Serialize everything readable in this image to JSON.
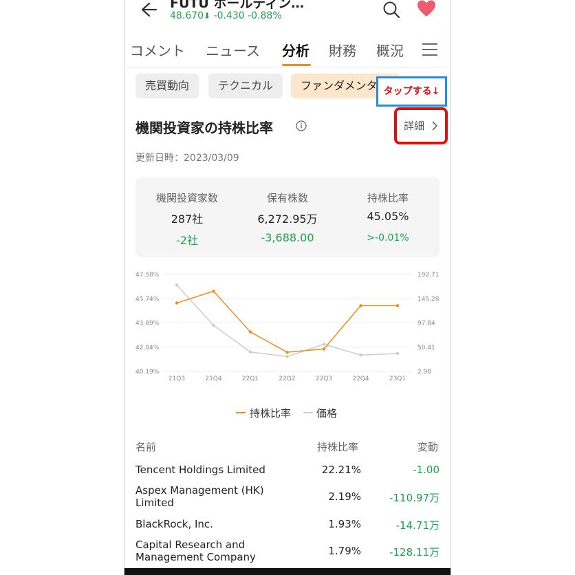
{
  "header": {
    "title": "FUTU ホールディン…",
    "price": "48.670",
    "change": "-0.430",
    "change_pct": "-0.88%",
    "down_arrow": "⬇"
  },
  "tabs": [
    {
      "label": "コメント"
    },
    {
      "label": "ニュース"
    },
    {
      "label": "分析"
    },
    {
      "label": "財務"
    },
    {
      "label": "概況"
    }
  ],
  "chips": [
    {
      "label": "売買動向"
    },
    {
      "label": "テクニカル"
    },
    {
      "label": "ファンダメンタ"
    }
  ],
  "annotation": {
    "tap_text": "タップする↓"
  },
  "section": {
    "title": "機関投資家の持株比率",
    "detail_link": "詳細",
    "updated": "更新日時：2023/03/09"
  },
  "stats": [
    {
      "label": "機関投資家数",
      "value": "287社",
      "change": "-2社"
    },
    {
      "label": "保有株数",
      "value": "6,272.95万",
      "change": "-3,688.00"
    },
    {
      "label": "持株比率",
      "value": "45.05%",
      "change": ">-0.01%"
    }
  ],
  "colors": {
    "accent": "#f08c1c",
    "down_green": "#1aa34a",
    "price_line": "#cccccc",
    "annotation_red": "#e01010",
    "annotation_blue": "#1e8ee9"
  },
  "chart_data": {
    "type": "line",
    "categories": [
      "21Q3",
      "21Q4",
      "22Q1",
      "22Q2",
      "22Q3",
      "22Q4",
      "23Q1"
    ],
    "left_axis_ticks": [
      "47.58%",
      "45.74%",
      "43.89%",
      "42.04%",
      "40.19%"
    ],
    "right_axis_ticks": [
      "192.71",
      "145.28",
      "97.84",
      "50.41",
      "2.98"
    ],
    "left_ylim": [
      40.19,
      47.58
    ],
    "right_ylim": [
      2.98,
      192.71
    ],
    "series": [
      {
        "name": "持株比率",
        "axis": "left",
        "color": "#f08c1c",
        "values": [
          45.4,
          46.3,
          43.2,
          41.65,
          41.9,
          45.2,
          45.2
        ]
      },
      {
        "name": "価格",
        "axis": "right",
        "color": "#cccccc",
        "values": [
          172.0,
          93.0,
          41.0,
          32.0,
          56.0,
          35.0,
          38.0
        ]
      }
    ],
    "grid": true
  },
  "table": {
    "headers": {
      "name": "名前",
      "ratio": "持株比率",
      "change": "変動"
    },
    "rows": [
      {
        "name": "Tencent Holdings Limited",
        "ratio": "22.21%",
        "change": "-1.00"
      },
      {
        "name": "Aspex Management (HK) Limited",
        "ratio": "2.19%",
        "change": "-110.97万"
      },
      {
        "name": "BlackRock, Inc.",
        "ratio": "1.93%",
        "change": "-14.71万"
      },
      {
        "name": "Capital Research and Management Company",
        "ratio": "1.79%",
        "change": "-128.11万"
      }
    ]
  }
}
